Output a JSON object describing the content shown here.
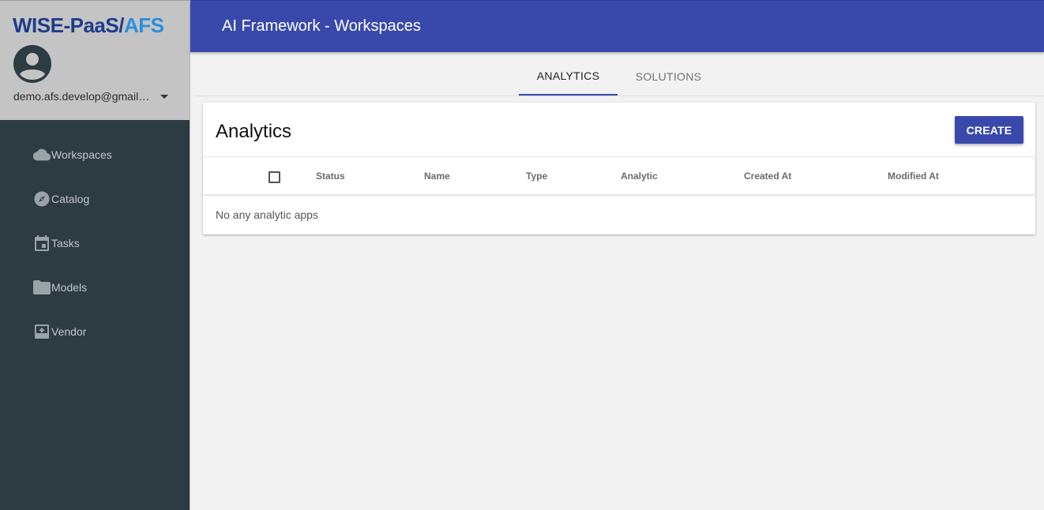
{
  "brand": {
    "part1": "WISE-PaaS/",
    "part2": "AFS"
  },
  "user": {
    "email": "demo.afs.develop@gmail.com"
  },
  "nav": [
    {
      "label": "Workspaces",
      "icon": "cloud-icon"
    },
    {
      "label": "Catalog",
      "icon": "compass-icon"
    },
    {
      "label": "Tasks",
      "icon": "calendar-icon"
    },
    {
      "label": "Models",
      "icon": "folder-icon"
    },
    {
      "label": "Vendor",
      "icon": "archive-icon"
    }
  ],
  "appbar": {
    "title": "AI Framework - Workspaces"
  },
  "tabs": [
    {
      "label": "ANALYTICS",
      "active": true
    },
    {
      "label": "SOLUTIONS",
      "active": false
    }
  ],
  "card": {
    "title": "Analytics",
    "create_label": "CREATE",
    "columns": [
      "Status",
      "Name",
      "Type",
      "Analytic",
      "Created At",
      "Modified At"
    ],
    "empty_message": "No any analytic apps"
  },
  "colors": {
    "primary": "#3949ab",
    "sidebar_bg": "#2d3b43",
    "sidebar_header_bg": "#c4c4c4",
    "brand_dark": "#1e3c8c",
    "brand_light": "#2a8fe0"
  }
}
